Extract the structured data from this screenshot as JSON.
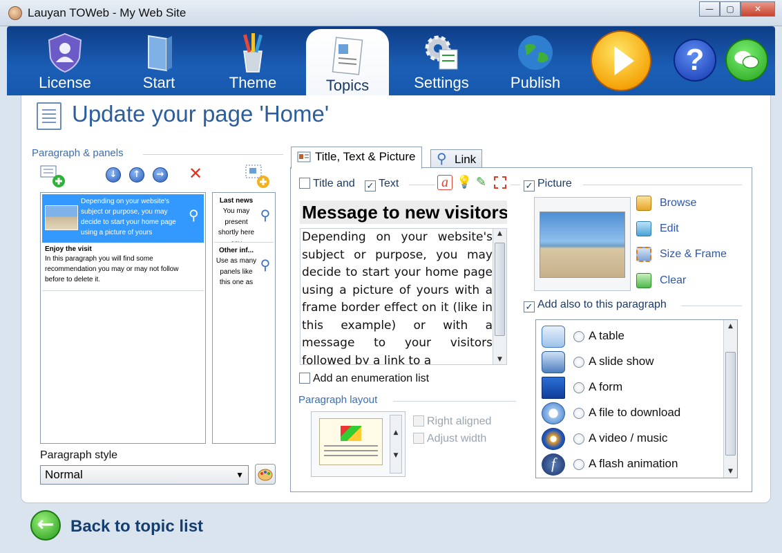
{
  "window": {
    "title": "Lauyan TOWeb - My Web Site",
    "buttons": {
      "minimize": "—",
      "maximize": "▢",
      "close": "✕"
    }
  },
  "nav": {
    "items": [
      {
        "label": "License",
        "icon": "shield-user-icon"
      },
      {
        "label": "Start",
        "icon": "book-icon"
      },
      {
        "label": "Theme",
        "icon": "brushes-icon"
      },
      {
        "label": "Topics",
        "icon": "notepad-icon",
        "active": true
      },
      {
        "label": "Settings",
        "icon": "gear-icon"
      },
      {
        "label": "Publish",
        "icon": "globe-icon"
      }
    ],
    "actions": [
      {
        "icon": "play-icon",
        "glyph": "▶"
      },
      {
        "icon": "help-icon",
        "glyph": "?"
      },
      {
        "icon": "chat-icon",
        "glyph": "●"
      }
    ]
  },
  "page": {
    "title": "Update your page 'Home'"
  },
  "left": {
    "section_label": "Paragraph & panels",
    "toolbar": {
      "move_down": "↓",
      "move_up": "↑",
      "move_right": "→",
      "delete": "✕"
    },
    "paragraphs": [
      {
        "title": "",
        "text": "Depending on your website's subject or purpose, you may decide to start your home page using a picture of yours",
        "selected": true
      },
      {
        "title": "Enjoy the visit",
        "text": "In this paragraph you will find some recommendation you may or may not follow before to delete it.",
        "selected": false
      }
    ],
    "panels": [
      {
        "title": "Last news",
        "text": "You may present shortly here any"
      },
      {
        "title": "Other inf...",
        "text": "Use as many panels like this one as"
      }
    ],
    "style_label": "Paragraph style",
    "style_value": "Normal"
  },
  "tabs": [
    {
      "label": "Title, Text & Picture",
      "active": true
    },
    {
      "label": "Link",
      "active": false
    }
  ],
  "editor": {
    "title_checkbox": {
      "label": "Title and",
      "checked": false
    },
    "text_checkbox": {
      "label": "Text",
      "checked": true
    },
    "picture_checkbox": {
      "label": "Picture",
      "checked": true
    },
    "heading": "Message to new visitors",
    "body": "Depending on your website's subject or purpose, you may decide to start your home page using a picture of yours with a frame border effect on it (like in this example) or with a message to your visitors followed by a link to a",
    "enum_checkbox": {
      "label": "Add an enumeration list",
      "checked": false
    },
    "layout_label": "Paragraph layout",
    "right_aligned": {
      "label": "Right aligned",
      "checked": false
    },
    "adjust_width": {
      "label": "Adjust width",
      "checked": false
    }
  },
  "picture": {
    "actions": [
      "Browse",
      "Edit",
      "Size & Frame",
      "Clear"
    ]
  },
  "add_also": {
    "checkbox": {
      "label": "Add also to this paragraph",
      "checked": true
    },
    "options": [
      {
        "label": "A table",
        "icon": "table-icon"
      },
      {
        "label": "A slide show",
        "icon": "slideshow-icon"
      },
      {
        "label": "A form",
        "icon": "form-icon"
      },
      {
        "label": "A file to download",
        "icon": "download-icon"
      },
      {
        "label": "A video / music",
        "icon": "media-icon"
      },
      {
        "label": "A flash animation",
        "icon": "flash-icon"
      }
    ]
  },
  "footer": {
    "back_label": "Back to topic list"
  },
  "colors": {
    "toolbar": "#1658ad",
    "accent_text": "#2c5e9e",
    "selection": "#3399ff"
  }
}
